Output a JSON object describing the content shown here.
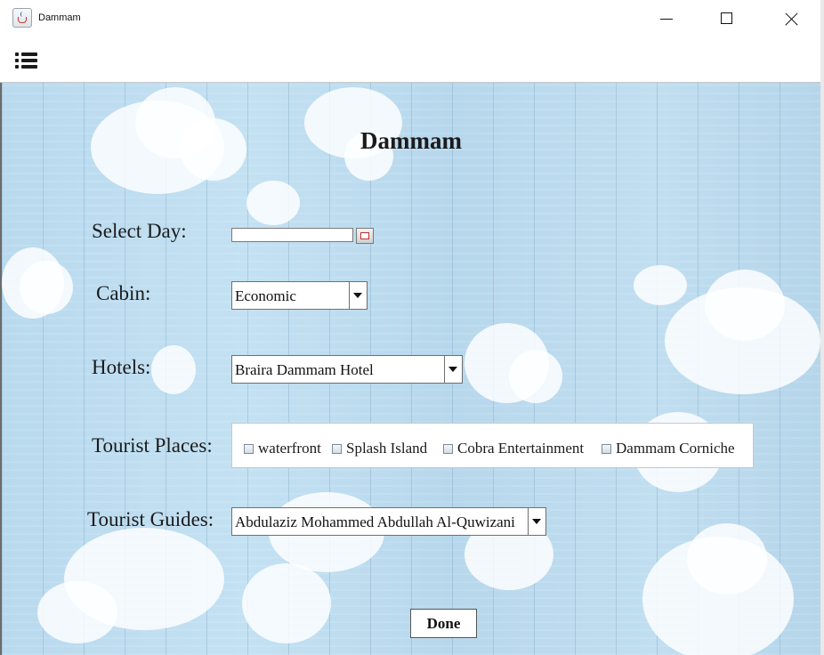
{
  "window": {
    "title": "Dammam"
  },
  "form": {
    "heading": "Dammam",
    "select_day": {
      "label": "Select Day:",
      "value": ""
    },
    "cabin": {
      "label": "Cabin:",
      "selected": "Economic"
    },
    "hotels": {
      "label": "Hotels:",
      "selected": "Braira Dammam Hotel"
    },
    "tourist_places": {
      "label": "Tourist Places:",
      "options": [
        {
          "label": "waterfront",
          "checked": false
        },
        {
          "label": "Splash Island",
          "checked": false
        },
        {
          "label": "Cobra Entertainment",
          "checked": false
        },
        {
          "label": "Dammam Corniche",
          "checked": false
        }
      ]
    },
    "tourist_guides": {
      "label": "Tourist Guides:",
      "selected": "Abdulaziz Mohammed Abdullah Al-Quwizani"
    },
    "done_label": "Done"
  },
  "icons": {
    "app": "java-coffee-cup-icon",
    "menu": "menu-list-icon",
    "calendar": "calendar-icon",
    "minimize": "minimize-icon",
    "maximize": "maximize-icon",
    "close": "close-icon"
  },
  "colors": {
    "background": "#bcdcef",
    "panel": "#ffffff",
    "text": "#1b1b1b"
  }
}
